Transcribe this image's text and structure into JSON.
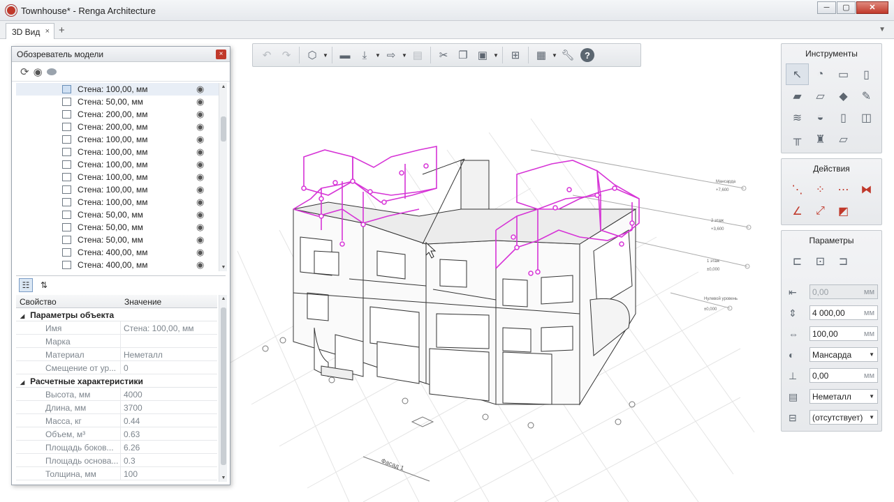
{
  "window": {
    "title": "Townhouse* - Renga Architecture",
    "min": "─",
    "max": "▢",
    "close": "✕"
  },
  "tabs": {
    "active": "3D Вид",
    "close": "×",
    "add": "+",
    "menu": "▼"
  },
  "toolbar": {
    "icons": [
      "undo-icon",
      "redo-icon",
      "view-cube-icon",
      "folder-open-icon",
      "import-icon",
      "export-icon",
      "print-icon",
      "cut-icon",
      "copy-icon",
      "paste-icon",
      "group-icon",
      "layout-icon",
      "wrench-icon",
      "help-icon"
    ],
    "help_label": "?"
  },
  "explorer": {
    "title": "Обозреватель модели",
    "close": "×",
    "items": [
      {
        "label": "Стена: 100,00, мм",
        "selected": true
      },
      {
        "label": "Стена: 50,00, мм",
        "selected": false
      },
      {
        "label": "Стена: 200,00, мм",
        "selected": false
      },
      {
        "label": "Стена: 200,00, мм",
        "selected": false
      },
      {
        "label": "Стена: 100,00, мм",
        "selected": false
      },
      {
        "label": "Стена: 100,00, мм",
        "selected": false
      },
      {
        "label": "Стена: 100,00, мм",
        "selected": false
      },
      {
        "label": "Стена: 100,00, мм",
        "selected": false
      },
      {
        "label": "Стена: 100,00, мм",
        "selected": false
      },
      {
        "label": "Стена: 100,00, мм",
        "selected": false
      },
      {
        "label": "Стена: 50,00, мм",
        "selected": false
      },
      {
        "label": "Стена: 50,00, мм",
        "selected": false
      },
      {
        "label": "Стена: 50,00, мм",
        "selected": false
      },
      {
        "label": "Стена: 400,00, мм",
        "selected": false
      },
      {
        "label": "Стена: 400,00, мм",
        "selected": false
      }
    ]
  },
  "properties": {
    "col_property": "Свойство",
    "col_value": "Значение",
    "group1": "Параметры объекта",
    "group1_rows": [
      {
        "key": "Имя",
        "value": "Стена: 100,00, мм"
      },
      {
        "key": "Марка",
        "value": ""
      },
      {
        "key": "Материал",
        "value": "Неметалл"
      },
      {
        "key": "Смещение от ур...",
        "value": "0"
      }
    ],
    "group2": "Расчетные характеристики",
    "group2_rows": [
      {
        "key": "Высота, мм",
        "value": "4000"
      },
      {
        "key": "Длина, мм",
        "value": "3700"
      },
      {
        "key": "Масса, кг",
        "value": "0.44"
      },
      {
        "key": "Объем, м³",
        "value": "0.63"
      },
      {
        "key": "Площадь боков...",
        "value": "6.26"
      },
      {
        "key": "Площадь основа...",
        "value": "0.3"
      },
      {
        "key": "Толщина, мм",
        "value": "100"
      }
    ]
  },
  "right_panels": {
    "tools_title": "Инструменты",
    "actions_title": "Действия",
    "params_title": "Параметры",
    "params": {
      "offset": {
        "value": "0,00",
        "unit": "мм"
      },
      "height": {
        "value": "4 000,00",
        "unit": "мм"
      },
      "thickness": {
        "value": "100,00",
        "unit": "мм"
      },
      "placement": {
        "value": "Мансарда"
      },
      "level_offset": {
        "value": "0,00",
        "unit": "мм"
      },
      "material": {
        "value": "Неметалл"
      },
      "marker": {
        "value": "(отсутствует)"
      }
    }
  },
  "drawing": {
    "facade_label": "Фасад 1",
    "level_labels": [
      "Мансарда",
      "2 этаж",
      "1 этаж",
      "Нулевой уровень"
    ],
    "level_values": [
      "+7,600",
      "+3,600",
      "±0,000",
      "±0,000"
    ],
    "accent_color": "#d633d6"
  }
}
